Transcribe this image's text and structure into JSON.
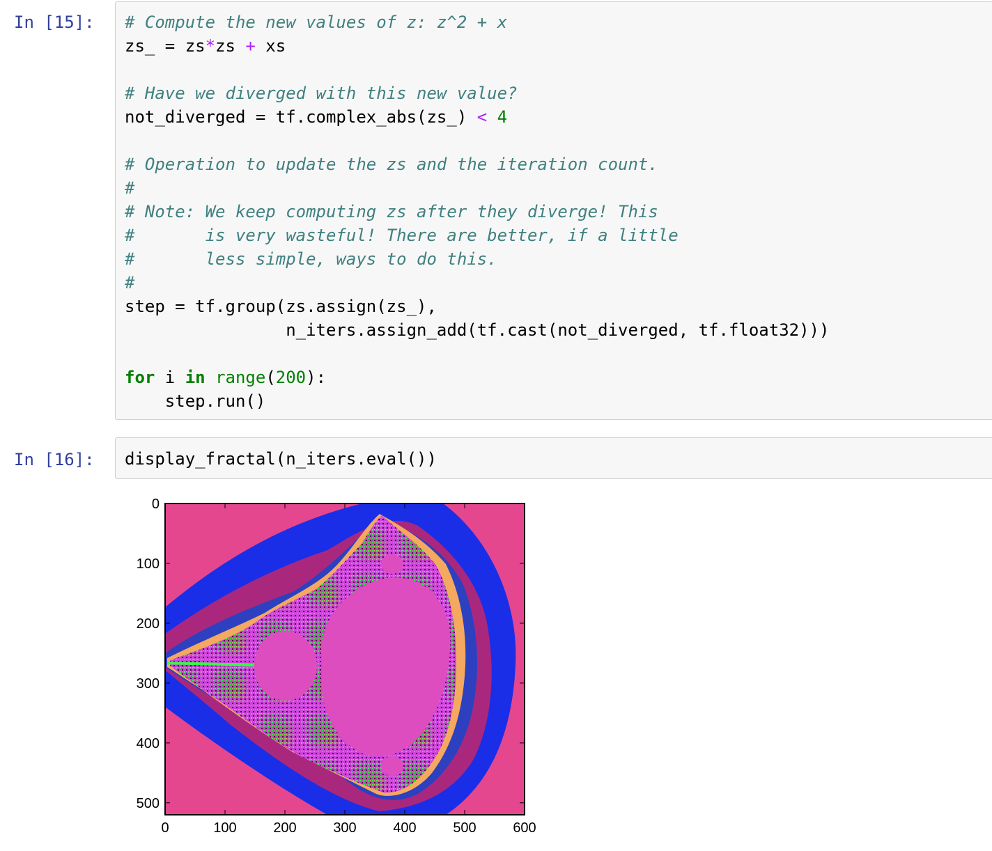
{
  "cells": [
    {
      "prompt": "In [15]:",
      "lines": [
        [
          {
            "t": "# Compute the new values of z: z^2 + x",
            "c": "cm"
          }
        ],
        [
          {
            "t": "zs_ = zs"
          },
          {
            "t": "*",
            "c": "op"
          },
          {
            "t": "zs "
          },
          {
            "t": "+",
            "c": "op"
          },
          {
            "t": " xs"
          }
        ],
        [],
        [
          {
            "t": "# Have we diverged with this new value?",
            "c": "cm"
          }
        ],
        [
          {
            "t": "not_diverged = tf.complex_abs(zs_) "
          },
          {
            "t": "<",
            "c": "op"
          },
          {
            "t": " "
          },
          {
            "t": "4",
            "c": "num"
          }
        ],
        [],
        [
          {
            "t": "# Operation to update the zs and the iteration count.",
            "c": "cm"
          }
        ],
        [
          {
            "t": "#",
            "c": "cm"
          }
        ],
        [
          {
            "t": "# Note: We keep computing zs after they diverge! This",
            "c": "cm"
          }
        ],
        [
          {
            "t": "#       is very wasteful! There are better, if a little",
            "c": "cm"
          }
        ],
        [
          {
            "t": "#       less simple, ways to do this.",
            "c": "cm"
          }
        ],
        [
          {
            "t": "#",
            "c": "cm"
          }
        ],
        [
          {
            "t": "step = tf.group(zs.assign(zs_),"
          }
        ],
        [
          {
            "t": "                n_iters.assign_add(tf.cast(not_diverged, tf.float32)))"
          }
        ],
        [],
        [
          {
            "t": "for",
            "c": "kw"
          },
          {
            "t": " i "
          },
          {
            "t": "in",
            "c": "kw"
          },
          {
            "t": " "
          },
          {
            "t": "range",
            "c": "bi"
          },
          {
            "t": "("
          },
          {
            "t": "200",
            "c": "num"
          },
          {
            "t": "):"
          }
        ],
        [
          {
            "t": "    step.run()"
          }
        ]
      ]
    },
    {
      "prompt": "In [16]:",
      "lines": [
        [
          {
            "t": "display_fractal(n_iters.eval())"
          }
        ]
      ]
    }
  ],
  "chart_data": {
    "type": "heatmap",
    "title": "",
    "xlabel": "",
    "ylabel": "",
    "xlim": [
      0,
      600
    ],
    "ylim": [
      520,
      0
    ],
    "x_ticks": [
      "0",
      "100",
      "200",
      "300",
      "400",
      "500",
      "600"
    ],
    "y_ticks": [
      "0",
      "100",
      "200",
      "300",
      "400",
      "500"
    ],
    "x_tick_values": [
      0,
      100,
      200,
      300,
      400,
      500,
      600
    ],
    "y_tick_values": [
      0,
      100,
      200,
      300,
      400,
      500
    ],
    "colors": {
      "background": "#e5478f",
      "band_outer": "#1a2ee8",
      "band_mid": "#a9287e",
      "band_blue2": "#2c40c0",
      "band_orange": "#f4a860",
      "band_violet": "#cc44d8",
      "band_dark": "#4a1040",
      "band_green": "#33ff44",
      "set": "#de4dbf"
    }
  }
}
